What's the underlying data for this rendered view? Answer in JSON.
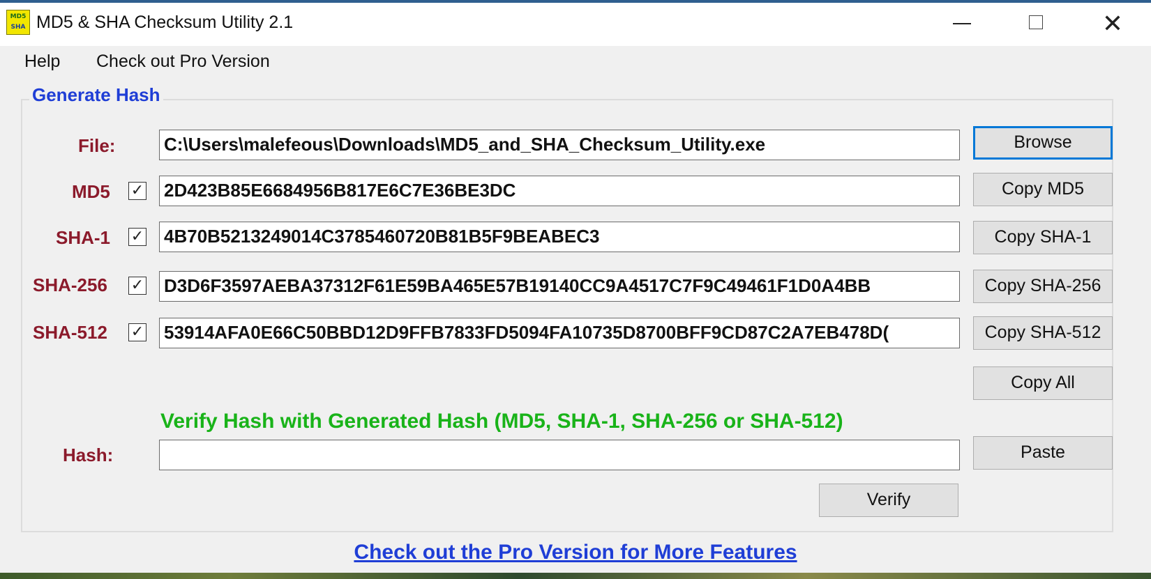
{
  "window": {
    "title": "MD5 & SHA Checksum Utility 2.1",
    "icon_text": [
      "MD5",
      "SHA"
    ],
    "controls": {
      "minimize": "",
      "maximize": "",
      "close": "✕"
    }
  },
  "menu": {
    "help": "Help",
    "pro": "Check out Pro Version"
  },
  "generate": {
    "title": "Generate Hash",
    "file_label": "File:",
    "file_value": "C:\\Users\\malefeous\\Downloads\\MD5_and_SHA_Checksum_Utility.exe",
    "browse_label": "Browse",
    "rows": [
      {
        "label": "MD5",
        "checked": true,
        "value": "2D423B85E6684956B817E6C7E36BE3DC",
        "button": "Copy MD5"
      },
      {
        "label": "SHA-1",
        "checked": true,
        "value": "4B70B5213249014C3785460720B81B5F9BEABEC3",
        "button": "Copy SHA-1"
      },
      {
        "label": "SHA-256",
        "checked": true,
        "value": "D3D6F3597AEBA37312F61E59BA465E57B19140CC9A4517C7F9C49461F1D0A4BB",
        "button": "Copy SHA-256"
      },
      {
        "label": "SHA-512",
        "checked": true,
        "value": "53914AFA0E66C50BBD12D9FFB7833FD5094FA10735D8700BFF9CD87C2A7EB478D(",
        "button": "Copy SHA-512"
      }
    ],
    "check_mark": "✓",
    "copy_all_label": "Copy All"
  },
  "verify": {
    "heading": "Verify Hash with Generated Hash (MD5, SHA-1, SHA-256 or SHA-512)",
    "hash_label": "Hash:",
    "hash_value": "",
    "paste_label": "Paste",
    "verify_label": "Verify"
  },
  "footer": {
    "link": "Check out the Pro Version for More Features"
  },
  "colors": {
    "label_red": "#8b1a2b",
    "title_blue": "#1f3ed6",
    "verify_green": "#19b319",
    "focus_blue": "#0078d7"
  }
}
